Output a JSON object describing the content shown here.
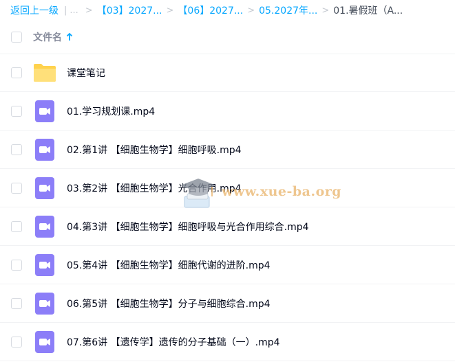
{
  "breadcrumb": {
    "back": "返回上一级",
    "divider": "|",
    "ellipsis": "...",
    "items": [
      "【03】2027...",
      "【06】2027...",
      "05.2027年..."
    ],
    "current": "01.暑假班（A..."
  },
  "header": {
    "file_name_label": "文件名"
  },
  "files": [
    {
      "name": "课堂笔记",
      "type": "folder"
    },
    {
      "name": "01.学习规划课.mp4",
      "type": "video"
    },
    {
      "name": "02.第1讲 【细胞生物学】细胞呼吸.mp4",
      "type": "video"
    },
    {
      "name": "03.第2讲 【细胞生物学】光合作用.mp4",
      "type": "video"
    },
    {
      "name": "04.第3讲 【细胞生物学】细胞呼吸与光合作用综合.mp4",
      "type": "video"
    },
    {
      "name": "05.第4讲 【细胞生物学】细胞代谢的进阶.mp4",
      "type": "video"
    },
    {
      "name": "06.第5讲 【细胞生物学】分子与细胞综合.mp4",
      "type": "video"
    },
    {
      "name": "07.第6讲 【遗传学】遗传的分子基础（一）.mp4",
      "type": "video"
    }
  ],
  "watermark": {
    "text": "www.xue-ba.org"
  },
  "colors": {
    "link": "#06a7ff",
    "folder": "#ffd24d",
    "video": "#8c7ef8"
  }
}
